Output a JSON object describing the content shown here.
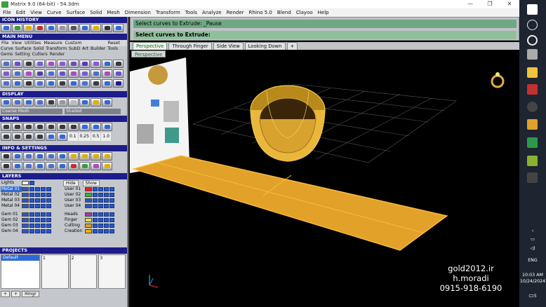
{
  "window": {
    "title": "Matrix 9.0 (64-bit) - 54.3dm",
    "controls": [
      "—",
      "❐",
      "✕"
    ]
  },
  "menu": [
    "File",
    "Edit",
    "View",
    "Curve",
    "Surface",
    "Solid",
    "Mesh",
    "Dimension",
    "Transform",
    "Tools",
    "Analyze",
    "Render",
    "Rhino 5.0",
    "Blend",
    "Clayoo",
    "Help"
  ],
  "panels": {
    "icon_history": "ICON HISTORY",
    "main_menu": "MAIN MENU",
    "main_menu_tabs": [
      "File",
      "View",
      "Utilities",
      "Measure",
      "Custom",
      "Reset"
    ],
    "main_menu_items": [
      "Curve",
      "Surface",
      "Solid",
      "Transform",
      "SubD",
      "Art",
      "Builder",
      "Tools",
      "Gems",
      "Setting",
      "Cutters",
      "Render"
    ],
    "display": "DISPLAY",
    "display_modes": [
      "Coarse Mesh",
      "Shaded"
    ],
    "snaps": "SNAPS",
    "snap_values": [
      "0.1",
      "0.25",
      "0.5",
      "1.0"
    ],
    "info_settings": "INFO & SETTINGS",
    "layers": "LAYERS",
    "lights": "Lights",
    "hide": "Hide",
    "show": "Show",
    "projects": "PROJECTS",
    "default_project": "Default",
    "slots": [
      "1",
      "2",
      "3"
    ],
    "add": "+",
    "hmgr": "Hmgr"
  },
  "layers_left": [
    {
      "name": "Metal 01",
      "color": "#2b57c8"
    },
    {
      "name": "Metal 02",
      "color": "#2b57c8"
    },
    {
      "name": "Metal 03",
      "color": "#2b57c8"
    },
    {
      "name": "Metal 04",
      "color": "#2b57c8"
    },
    {
      "name": "Gem 01",
      "color": "#2b57c8"
    },
    {
      "name": "Gem 02",
      "color": "#2b57c8"
    },
    {
      "name": "Gem 03",
      "color": "#2b57c8"
    },
    {
      "name": "Gem 04",
      "color": "#2b57c8"
    }
  ],
  "layers_right": [
    {
      "name": "User 01",
      "color": "#e82020"
    },
    {
      "name": "User 02",
      "color": "#2bbd2b"
    },
    {
      "name": "User 03",
      "color": "#2b57c8"
    },
    {
      "name": "User 04",
      "color": "#2b57c8"
    },
    {
      "name": "Heads",
      "color": "#b030b0"
    },
    {
      "name": "Finger",
      "color": "#e0e040"
    },
    {
      "name": "Cutting",
      "color": "#e0a020"
    },
    {
      "name": "Creation",
      "color": "#f0b000"
    }
  ],
  "command": {
    "line1": "Select curves to Extrude: _Pause",
    "line2": "Select curves to Extrude:"
  },
  "viewport_tabs": [
    "Perspective",
    "Through Finger",
    "Side View",
    "Looking Down",
    "+"
  ],
  "viewport_label": "Perspective",
  "overlay": {
    "line1": "gold2012.ir",
    "line2": "h.moradi",
    "line3": "0915-918-6190"
  },
  "taskbar": {
    "language": "ENG",
    "time": "10:03 AM",
    "date": "10/24/2024",
    "notify": "5"
  }
}
